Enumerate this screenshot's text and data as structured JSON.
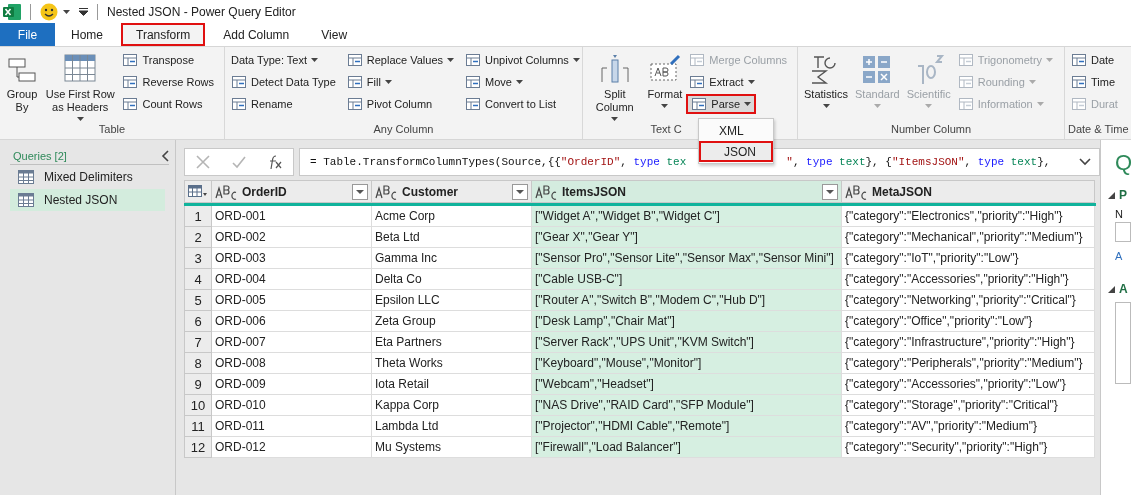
{
  "window": {
    "title": "Nested JSON - Power Query Editor"
  },
  "tabs": [
    {
      "label": "File",
      "kind": "file",
      "selected": false,
      "highlighted": false
    },
    {
      "label": "Home",
      "kind": "tab",
      "selected": false,
      "highlighted": false
    },
    {
      "label": "Transform",
      "kind": "tab",
      "selected": true,
      "highlighted": true
    },
    {
      "label": "Add Column",
      "kind": "tab",
      "selected": false,
      "highlighted": false
    },
    {
      "label": "View",
      "kind": "tab",
      "selected": false,
      "highlighted": false
    }
  ],
  "ribbon": {
    "groups": [
      {
        "label": "Table",
        "items": [
          {
            "kind": "large",
            "label": "Group By",
            "dropdown": false,
            "disabled": false
          },
          {
            "kind": "large",
            "label": "Use First Row as Headers",
            "dropdown": true,
            "disabled": false
          },
          {
            "kind": "stack",
            "buttons": [
              {
                "label": "Transpose",
                "dropdown": false,
                "disabled": false,
                "highlighted": false
              },
              {
                "label": "Reverse Rows",
                "dropdown": false,
                "disabled": false,
                "highlighted": false
              },
              {
                "label": "Count Rows",
                "dropdown": false,
                "disabled": false,
                "highlighted": false
              }
            ]
          }
        ]
      },
      {
        "label": "Any Column",
        "items": [
          {
            "kind": "stack",
            "buttons": [
              {
                "label": "Data Type: Text",
                "dropdown": true,
                "disabled": false,
                "highlighted": false,
                "icon": false
              },
              {
                "label": "Detect Data Type",
                "dropdown": false,
                "disabled": false,
                "highlighted": false
              },
              {
                "label": "Rename",
                "dropdown": false,
                "disabled": false,
                "highlighted": false
              }
            ]
          },
          {
            "kind": "stack",
            "buttons": [
              {
                "label": "Replace Values",
                "dropdown": true,
                "disabled": false,
                "highlighted": false
              },
              {
                "label": "Fill",
                "dropdown": true,
                "disabled": false,
                "highlighted": false
              },
              {
                "label": "Pivot Column",
                "dropdown": false,
                "disabled": false,
                "highlighted": false
              }
            ]
          },
          {
            "kind": "stack",
            "buttons": [
              {
                "label": "Unpivot Columns",
                "dropdown": true,
                "disabled": false,
                "highlighted": false
              },
              {
                "label": "Move",
                "dropdown": true,
                "disabled": false,
                "highlighted": false
              },
              {
                "label": "Convert to List",
                "dropdown": false,
                "disabled": false,
                "highlighted": false
              }
            ]
          }
        ]
      },
      {
        "label": "Text C",
        "items": [
          {
            "kind": "large",
            "label": "Split Column",
            "dropdown": true,
            "disabled": false
          },
          {
            "kind": "large",
            "label": "Format",
            "dropdown": true,
            "disabled": false
          },
          {
            "kind": "stack",
            "buttons": [
              {
                "label": "Merge Columns",
                "dropdown": false,
                "disabled": true,
                "highlighted": false
              },
              {
                "label": "Extract",
                "dropdown": true,
                "disabled": false,
                "highlighted": false
              },
              {
                "label": "Parse",
                "dropdown": true,
                "disabled": false,
                "highlighted": true,
                "expanded": true
              }
            ]
          }
        ]
      },
      {
        "label": "Number Column",
        "items": [
          {
            "kind": "large",
            "label": "Statistics",
            "dropdown": true,
            "disabled": false
          },
          {
            "kind": "large",
            "label": "Standard",
            "dropdown": true,
            "disabled": true
          },
          {
            "kind": "large",
            "label": "Scientific",
            "dropdown": true,
            "disabled": true
          },
          {
            "kind": "stack",
            "buttons": [
              {
                "label": "Trigonometry",
                "dropdown": true,
                "disabled": true,
                "highlighted": false
              },
              {
                "label": "Rounding",
                "dropdown": true,
                "disabled": true,
                "highlighted": false
              },
              {
                "label": "Information",
                "dropdown": true,
                "disabled": true,
                "highlighted": false
              }
            ]
          }
        ]
      },
      {
        "label": "Date & Time",
        "items": [
          {
            "kind": "stack",
            "buttons": [
              {
                "label": "Date",
                "dropdown": false,
                "disabled": false,
                "highlighted": false
              },
              {
                "label": "Time",
                "dropdown": false,
                "disabled": false,
                "highlighted": false
              },
              {
                "label": "Durat",
                "dropdown": false,
                "disabled": true,
                "highlighted": false
              }
            ]
          }
        ]
      }
    ]
  },
  "parse_menu": {
    "items": [
      {
        "label": "XML",
        "highlighted": false
      },
      {
        "label": "JSON",
        "highlighted": true
      }
    ]
  },
  "queries": {
    "title": "Queries [2]",
    "items": [
      {
        "label": "Mixed Delimiters",
        "selected": false
      },
      {
        "label": "Nested JSON",
        "selected": true
      }
    ]
  },
  "formula": {
    "before": [
      {
        "kind": "plain",
        "text": "= Table.TransformColumnTypes(Source,{{"
      },
      {
        "kind": "string",
        "text": "\"OrderID\""
      },
      {
        "kind": "plain",
        "text": ", "
      },
      {
        "kind": "keyword",
        "text": "type"
      },
      {
        "kind": "type",
        "text": " tex"
      }
    ],
    "after": [
      {
        "kind": "string",
        "text": "\""
      },
      {
        "kind": "plain",
        "text": ", "
      },
      {
        "kind": "keyword",
        "text": "type"
      },
      {
        "kind": "type",
        "text": " text"
      },
      {
        "kind": "plain",
        "text": "}, {"
      },
      {
        "kind": "string",
        "text": "\"ItemsJSON\""
      },
      {
        "kind": "plain",
        "text": ", "
      },
      {
        "kind": "keyword",
        "text": "type"
      },
      {
        "kind": "type",
        "text": " text"
      },
      {
        "kind": "plain",
        "text": "},"
      }
    ]
  },
  "table": {
    "columns": [
      {
        "label": "OrderID",
        "filter": true,
        "selected": false
      },
      {
        "label": "Customer",
        "filter": true,
        "selected": false
      },
      {
        "label": "ItemsJSON",
        "filter": true,
        "selected": true
      },
      {
        "label": "MetaJSON",
        "filter": false,
        "selected": false
      }
    ],
    "rows": [
      {
        "number": "1",
        "cells": [
          "ORD-001",
          "Acme Corp",
          "[\"Widget A\",\"Widget B\",\"Widget C\"]",
          "{\"category\":\"Electronics\",\"priority\":\"High\"}"
        ]
      },
      {
        "number": "2",
        "cells": [
          "ORD-002",
          "Beta Ltd",
          "[\"Gear X\",\"Gear Y\"]",
          "{\"category\":\"Mechanical\",\"priority\":\"Medium\"}"
        ]
      },
      {
        "number": "3",
        "cells": [
          "ORD-003",
          "Gamma Inc",
          "[\"Sensor Pro\",\"Sensor Lite\",\"Sensor Max\",\"Sensor Mini\"]",
          "{\"category\":\"IoT\",\"priority\":\"Low\"}"
        ]
      },
      {
        "number": "4",
        "cells": [
          "ORD-004",
          "Delta Co",
          "[\"Cable USB-C\"]",
          "{\"category\":\"Accessories\",\"priority\":\"High\"}"
        ]
      },
      {
        "number": "5",
        "cells": [
          "ORD-005",
          "Epsilon LLC",
          "[\"Router A\",\"Switch B\",\"Modem C\",\"Hub D\"]",
          "{\"category\":\"Networking\",\"priority\":\"Critical\"}"
        ]
      },
      {
        "number": "6",
        "cells": [
          "ORD-006",
          "Zeta Group",
          "[\"Desk Lamp\",\"Chair Mat\"]",
          "{\"category\":\"Office\",\"priority\":\"Low\"}"
        ]
      },
      {
        "number": "7",
        "cells": [
          "ORD-007",
          "Eta Partners",
          "[\"Server Rack\",\"UPS Unit\",\"KVM Switch\"]",
          "{\"category\":\"Infrastructure\",\"priority\":\"High\"}"
        ]
      },
      {
        "number": "8",
        "cells": [
          "ORD-008",
          "Theta Works",
          "[\"Keyboard\",\"Mouse\",\"Monitor\"]",
          "{\"category\":\"Peripherals\",\"priority\":\"Medium\"}"
        ]
      },
      {
        "number": "9",
        "cells": [
          "ORD-009",
          "Iota Retail",
          "[\"Webcam\",\"Headset\"]",
          "{\"category\":\"Accessories\",\"priority\":\"Low\"}"
        ]
      },
      {
        "number": "10",
        "cells": [
          "ORD-010",
          "Kappa Corp",
          "[\"NAS Drive\",\"RAID Card\",\"SFP Module\"]",
          "{\"category\":\"Storage\",\"priority\":\"Critical\"}"
        ]
      },
      {
        "number": "11",
        "cells": [
          "ORD-011",
          "Lambda Ltd",
          "[\"Projector\",\"HDMI Cable\",\"Remote\"]",
          "{\"category\":\"AV\",\"priority\":\"Medium\"}"
        ]
      },
      {
        "number": "12",
        "cells": [
          "ORD-012",
          "Mu Systems",
          "[\"Firewall\",\"Load Balancer\"]",
          "{\"category\":\"Security\",\"priority\":\"High\"}"
        ]
      }
    ]
  },
  "settings_pane": {
    "title": "Q",
    "sections": [
      {
        "heading": "P",
        "texts": [
          "N"
        ],
        "link": "A"
      },
      {
        "heading": "A"
      }
    ]
  }
}
